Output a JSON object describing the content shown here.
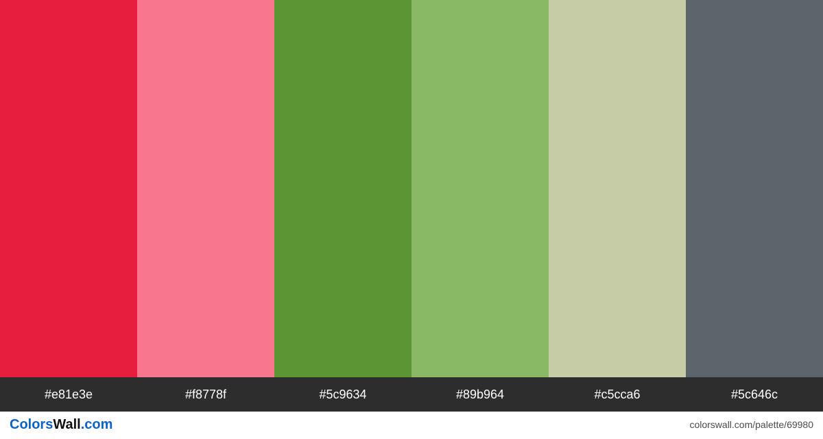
{
  "palette": {
    "colors": [
      {
        "hex": "#e81e3e"
      },
      {
        "hex": "#f8778f"
      },
      {
        "hex": "#5c9634"
      },
      {
        "hex": "#89b964"
      },
      {
        "hex": "#c5cca6"
      },
      {
        "hex": "#5c646c"
      }
    ]
  },
  "brand": {
    "part1": "Colors",
    "part2": "Wall",
    "suffix": ".com"
  },
  "permalink": "colorswall.com/palette/69980"
}
